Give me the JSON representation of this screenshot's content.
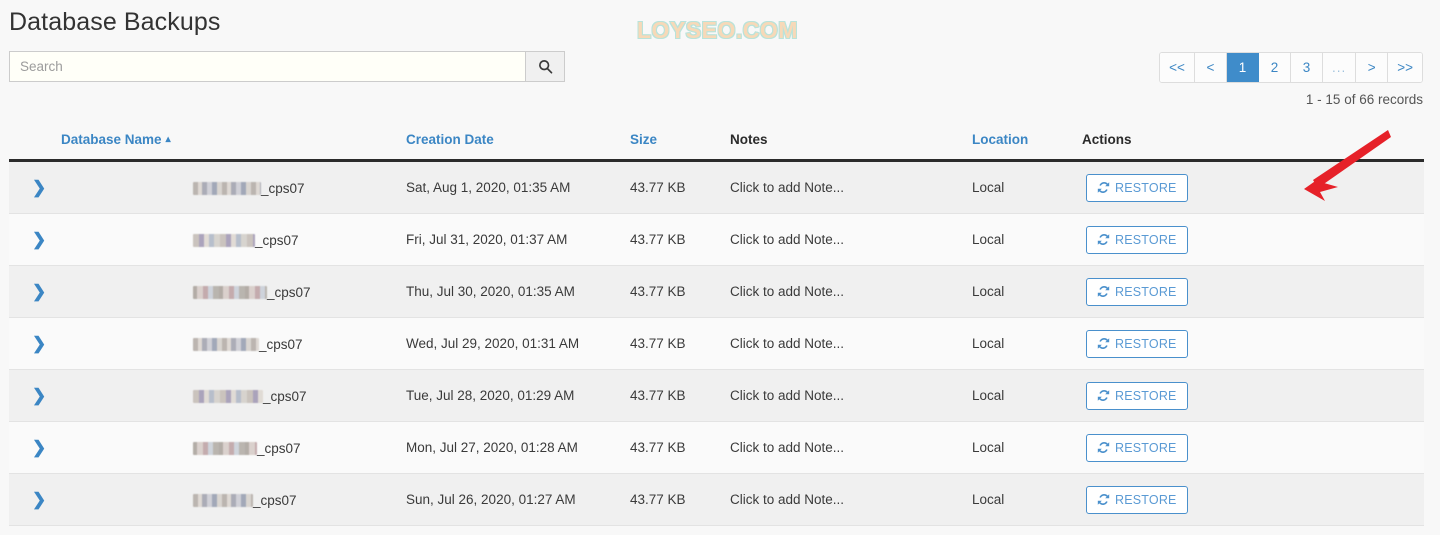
{
  "page": {
    "title": "Database Backups",
    "watermark": "LOYSEO.COM"
  },
  "search": {
    "placeholder": "Search",
    "value": "",
    "icon": "search-icon"
  },
  "pagination": {
    "buttons": [
      {
        "label": "<<",
        "name": "first-page",
        "active": false
      },
      {
        "label": "<",
        "name": "prev-page",
        "active": false
      },
      {
        "label": "1",
        "name": "page-1",
        "active": true
      },
      {
        "label": "2",
        "name": "page-2",
        "active": false
      },
      {
        "label": "3",
        "name": "page-3",
        "active": false
      },
      {
        "label": "...",
        "name": "page-ellipsis",
        "active": false
      },
      {
        "label": ">",
        "name": "next-page",
        "active": false
      },
      {
        "label": ">>",
        "name": "last-page",
        "active": false
      }
    ],
    "records_label": "1 - 15 of 66 records"
  },
  "table": {
    "columns": [
      {
        "label": "",
        "name": "expand",
        "sortable": false
      },
      {
        "label": "Database Name",
        "name": "database-name",
        "sortable": true,
        "sorted": "asc",
        "caret": "▴"
      },
      {
        "label": "Creation Date",
        "name": "creation-date",
        "sortable": true
      },
      {
        "label": "Size",
        "name": "size",
        "sortable": true
      },
      {
        "label": "Notes",
        "name": "notes",
        "sortable": false
      },
      {
        "label": "Location",
        "name": "location",
        "sortable": true
      },
      {
        "label": "Actions",
        "name": "actions",
        "sortable": false
      }
    ],
    "rows": [
      {
        "name_suffix": "_cps07",
        "date": "Sat, Aug 1, 2020, 01:35 AM",
        "size": "43.77 KB",
        "notes": "Click to add Note...",
        "location": "Local",
        "action": "RESTORE"
      },
      {
        "name_suffix": "_cps07",
        "date": "Fri, Jul 31, 2020, 01:37 AM",
        "size": "43.77 KB",
        "notes": "Click to add Note...",
        "location": "Local",
        "action": "RESTORE"
      },
      {
        "name_suffix": "_cps07",
        "date": "Thu, Jul 30, 2020, 01:35 AM",
        "size": "43.77 KB",
        "notes": "Click to add Note...",
        "location": "Local",
        "action": "RESTORE"
      },
      {
        "name_suffix": "_cps07",
        "date": "Wed, Jul 29, 2020, 01:31 AM",
        "size": "43.77 KB",
        "notes": "Click to add Note...",
        "location": "Local",
        "action": "RESTORE"
      },
      {
        "name_suffix": "_cps07",
        "date": "Tue, Jul 28, 2020, 01:29 AM",
        "size": "43.77 KB",
        "notes": "Click to add Note...",
        "location": "Local",
        "action": "RESTORE"
      },
      {
        "name_suffix": "_cps07",
        "date": "Mon, Jul 27, 2020, 01:28 AM",
        "size": "43.77 KB",
        "notes": "Click to add Note...",
        "location": "Local",
        "action": "RESTORE"
      },
      {
        "name_suffix": "_cps07",
        "date": "Sun, Jul 26, 2020, 01:27 AM",
        "size": "43.77 KB",
        "notes": "Click to add Note...",
        "location": "Local",
        "action": "RESTORE"
      }
    ],
    "expand_icon": "chevron-right-icon",
    "restore_icon": "refresh-icon"
  },
  "annotation": {
    "type": "red-arrow",
    "color": "#e62129",
    "points_to": "restore-button-row-1"
  },
  "colors": {
    "accent_blue": "#3b86c4",
    "active_page_bg": "#3f8cca",
    "header_rule": "#2b2b2b",
    "row_odd": "#f0f0f0",
    "row_even": "#fafafa",
    "page_bg": "#f8f8f8",
    "annotation_red": "#e62129"
  }
}
